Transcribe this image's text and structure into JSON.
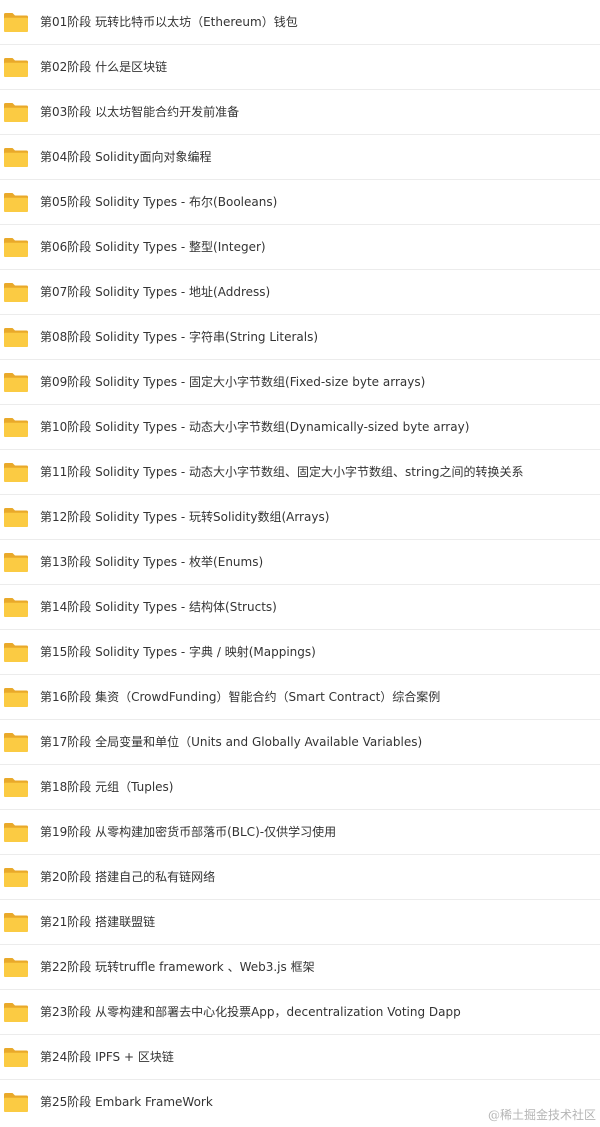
{
  "folders": [
    {
      "label": "第01阶段 玩转比特币以太坊（Ethereum）钱包",
      "icon": "folder-icon"
    },
    {
      "label": "第02阶段 什么是区块链",
      "icon": "folder-icon"
    },
    {
      "label": "第03阶段 以太坊智能合约开发前准备",
      "icon": "folder-icon"
    },
    {
      "label": "第04阶段 Solidity面向对象编程",
      "icon": "folder-icon"
    },
    {
      "label": "第05阶段 Solidity Types - 布尔(Booleans)",
      "icon": "folder-icon"
    },
    {
      "label": "第06阶段 Solidity Types - 整型(Integer)",
      "icon": "folder-icon"
    },
    {
      "label": "第07阶段 Solidity Types - 地址(Address)",
      "icon": "folder-icon"
    },
    {
      "label": "第08阶段 Solidity Types - 字符串(String Literals)",
      "icon": "folder-icon"
    },
    {
      "label": "第09阶段 Solidity Types - 固定大小字节数组(Fixed-size byte arrays)",
      "icon": "folder-icon"
    },
    {
      "label": "第10阶段 Solidity Types - 动态大小字节数组(Dynamically-sized byte array)",
      "icon": "folder-icon"
    },
    {
      "label": "第11阶段 Solidity Types - 动态大小字节数组、固定大小字节数组、string之间的转换关系",
      "icon": "folder-icon"
    },
    {
      "label": "第12阶段 Solidity Types - 玩转Solidity数组(Arrays)",
      "icon": "folder-icon"
    },
    {
      "label": "第13阶段 Solidity Types - 枚举(Enums)",
      "icon": "folder-icon"
    },
    {
      "label": "第14阶段 Solidity Types - 结构体(Structs)",
      "icon": "folder-icon"
    },
    {
      "label": "第15阶段 Solidity Types - 字典 / 映射(Mappings)",
      "icon": "folder-icon"
    },
    {
      "label": "第16阶段 集资（CrowdFunding）智能合约（Smart Contract）综合案例",
      "icon": "folder-icon"
    },
    {
      "label": "第17阶段 全局变量和单位（Units and Globally Available Variables)",
      "icon": "folder-icon"
    },
    {
      "label": "第18阶段 元组（Tuples)",
      "icon": "folder-icon"
    },
    {
      "label": "第19阶段 从零构建加密货币部落币(BLC)-仅供学习使用",
      "icon": "folder-icon"
    },
    {
      "label": "第20阶段 搭建自己的私有链网络",
      "icon": "folder-icon"
    },
    {
      "label": "第21阶段 搭建联盟链",
      "icon": "folder-icon"
    },
    {
      "label": "第22阶段 玩转truffle framework 、Web3.js 框架",
      "icon": "folder-icon"
    },
    {
      "label": "第23阶段 从零构建和部署去中心化投票App，decentralization Voting Dapp",
      "icon": "folder-icon"
    },
    {
      "label": "第24阶段 IPFS + 区块链",
      "icon": "folder-icon"
    },
    {
      "label": "第25阶段 Embark FrameWork",
      "icon": "folder-icon"
    }
  ],
  "watermark": "@稀土掘金技术社区",
  "colors": {
    "folder_back": "#e9a92a",
    "folder_front": "#fbcb43",
    "text": "#333333",
    "divider": "#ececec"
  }
}
